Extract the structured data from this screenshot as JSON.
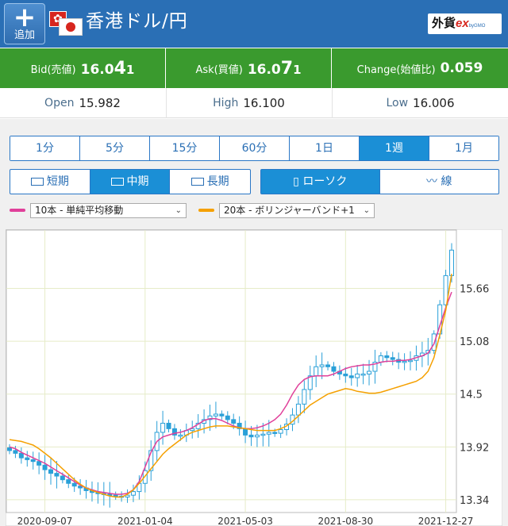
{
  "header": {
    "add_label": "追加",
    "hk_flag_glyph": "✿",
    "title": "香港ドル/円",
    "brand": {
      "part1": "外貨",
      "part2": "ex",
      "part3": "byGMO"
    }
  },
  "quote": {
    "bid": {
      "label": "Bid(売値)",
      "head": "16.0",
      "big": "4",
      "tail": "1"
    },
    "ask": {
      "label": "Ask(買値)",
      "head": "16.0",
      "big": "7",
      "tail": "1"
    },
    "change": {
      "label": "Change(始値比)",
      "value": "0.059"
    }
  },
  "stats": {
    "open": {
      "label": "Open",
      "value": "15.982"
    },
    "high": {
      "label": "High",
      "value": "16.100"
    },
    "low": {
      "label": "Low",
      "value": "16.006"
    }
  },
  "timeframes": [
    "1分",
    "5分",
    "15分",
    "60分",
    "1日",
    "1週",
    "1月"
  ],
  "active_timeframe": "1週",
  "periods": [
    {
      "icon": "short-term-icon",
      "label": "短期"
    },
    {
      "icon": "mid-term-icon",
      "label": "中期"
    },
    {
      "icon": "long-term-icon",
      "label": "長期"
    }
  ],
  "active_period": "中期",
  "chart_types": [
    {
      "icon": "candlestick-icon",
      "label": "ローソク"
    },
    {
      "icon": "line-chart-icon",
      "label": "線"
    }
  ],
  "active_chart_type": "ローソク",
  "indicators": [
    {
      "color": "#e0409a",
      "value": "10本 - 単純平均移動"
    },
    {
      "color": "#f5a000",
      "value": "20本 - ボリンジャーバンド+1"
    }
  ],
  "colors": {
    "header_bg": "#2a6fb5",
    "quote_bg": "#3a9a2e",
    "active_tab": "#1b8fd6",
    "candle": "#2aa0d8",
    "ma": "#e0409a",
    "band": "#f5a000"
  },
  "chart_data": {
    "type": "candlestick",
    "title": "",
    "xlabel": "",
    "ylabel": "",
    "x_ticks": [
      "2020-09-07",
      "2021-01-04",
      "2021-05-03",
      "2021-08-30",
      "2021-12-27"
    ],
    "x_tick_index": [
      6,
      23,
      40,
      57,
      74
    ],
    "y_ticks": [
      13.34,
      13.92,
      14.5,
      15.08,
      15.66
    ],
    "ylim": [
      13.2,
      16.3
    ],
    "grid": true,
    "close": [
      13.88,
      13.85,
      13.8,
      13.78,
      13.76,
      13.72,
      13.67,
      13.63,
      13.6,
      13.56,
      13.52,
      13.49,
      13.47,
      13.44,
      13.42,
      13.41,
      13.4,
      13.39,
      13.38,
      13.37,
      13.39,
      13.43,
      13.52,
      13.66,
      13.88,
      14.08,
      14.18,
      14.12,
      14.05,
      14.05,
      14.1,
      14.12,
      14.18,
      14.22,
      14.26,
      14.28,
      14.26,
      14.22,
      14.18,
      14.12,
      14.05,
      14.03,
      14.05,
      14.06,
      14.08,
      14.07,
      14.11,
      14.17,
      14.27,
      14.39,
      14.55,
      14.7,
      14.8,
      14.82,
      14.8,
      14.75,
      14.72,
      14.7,
      14.68,
      14.72,
      14.72,
      14.75,
      14.85,
      14.92,
      14.9,
      14.88,
      14.85,
      14.86,
      14.87,
      14.92,
      14.95,
      14.98,
      15.16,
      15.48,
      15.8,
      16.08
    ],
    "series": [
      {
        "name": "10本 - 単純平均移動",
        "values": [
          13.92,
          13.9,
          13.86,
          13.83,
          13.8,
          13.77,
          13.74,
          13.7,
          13.66,
          13.62,
          13.58,
          13.54,
          13.5,
          13.47,
          13.45,
          13.43,
          13.42,
          13.41,
          13.4,
          13.4,
          13.41,
          13.45,
          13.54,
          13.7,
          13.86,
          13.98,
          14.03,
          14.05,
          14.07,
          14.08,
          14.1,
          14.13,
          14.17,
          14.21,
          14.23,
          14.23,
          14.21,
          14.18,
          14.15,
          14.13,
          14.12,
          14.12,
          14.13,
          14.15,
          14.18,
          14.22,
          14.28,
          14.38,
          14.5,
          14.6,
          14.66,
          14.69,
          14.7,
          14.7,
          14.7,
          14.72,
          14.75,
          14.78,
          14.8,
          14.81,
          14.82,
          14.82,
          14.83,
          14.85,
          14.86,
          14.86,
          14.87,
          14.87,
          14.88,
          14.9,
          14.92,
          14.95,
          15.05,
          15.25,
          15.45,
          15.62
        ]
      },
      {
        "name": "20本 - ボリンジャーバンド+1",
        "values": [
          14.0,
          13.99,
          13.98,
          13.96,
          13.94,
          13.9,
          13.85,
          13.8,
          13.74,
          13.68,
          13.62,
          13.56,
          13.51,
          13.47,
          13.44,
          13.42,
          13.4,
          13.38,
          13.37,
          13.37,
          13.4,
          13.45,
          13.52,
          13.6,
          13.68,
          13.76,
          13.84,
          13.9,
          13.95,
          14.0,
          14.05,
          14.08,
          14.1,
          14.12,
          14.14,
          14.15,
          14.15,
          14.15,
          14.14,
          14.13,
          14.12,
          14.11,
          14.1,
          14.1,
          14.1,
          14.1,
          14.12,
          14.15,
          14.2,
          14.26,
          14.32,
          14.38,
          14.42,
          14.46,
          14.5,
          14.52,
          14.54,
          14.56,
          14.55,
          14.53,
          14.52,
          14.51,
          14.51,
          14.52,
          14.54,
          14.56,
          14.58,
          14.6,
          14.62,
          14.64,
          14.68,
          14.75,
          14.9,
          15.15,
          15.42,
          15.82
        ]
      }
    ]
  }
}
